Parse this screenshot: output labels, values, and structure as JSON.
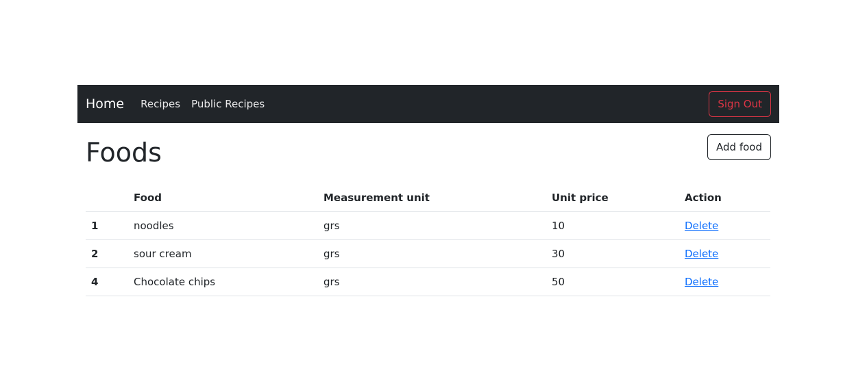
{
  "navbar": {
    "brand": "Home",
    "links": [
      "Recipes",
      "Public Recipes"
    ],
    "sign_out_label": "Sign Out"
  },
  "page": {
    "title": "Foods",
    "add_button_label": "Add food"
  },
  "table": {
    "headers": [
      "",
      "Food",
      "Measurement unit",
      "Unit price",
      "Action"
    ],
    "rows": [
      {
        "num": "1",
        "food": "noodles",
        "unit": "grs",
        "price": "10",
        "action": "Delete"
      },
      {
        "num": "2",
        "food": "sour cream",
        "unit": "grs",
        "price": "30",
        "action": "Delete"
      },
      {
        "num": "4",
        "food": "Chocolate chips",
        "unit": "grs",
        "price": "50",
        "action": "Delete"
      }
    ]
  },
  "colors": {
    "navbar_bg": "#212529",
    "danger": "#dc3545",
    "link": "#0d6efd"
  }
}
